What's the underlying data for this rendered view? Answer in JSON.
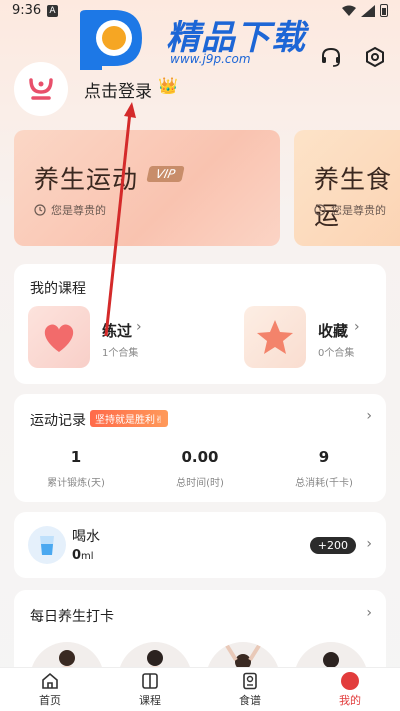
{
  "status": {
    "time": "9:36",
    "a_icon": "A"
  },
  "watermark": {
    "title": "精品下载",
    "url": "www.j9p.com"
  },
  "header": {
    "login_text": "点击登录",
    "avatar_icon": "logo-icon",
    "support_icon": "headset-icon",
    "settings_icon": "gear-icon"
  },
  "vip_cards": [
    {
      "title": "养生运动",
      "badge": "VIP",
      "subtitle": "您是尊贵的"
    },
    {
      "title": "养生食运",
      "subtitle": "您是尊贵的"
    }
  ],
  "courses": {
    "title": "我的课程",
    "items": [
      {
        "name": "练过",
        "count": "1个合集"
      },
      {
        "name": "收藏",
        "count": "0个合集"
      }
    ]
  },
  "record": {
    "title": "运动记录",
    "badge": "坚持就是胜利✌",
    "stats": [
      {
        "value": "1",
        "label": "累计锻炼(天)"
      },
      {
        "value": "0.00",
        "label": "总时间(时)"
      },
      {
        "value": "9",
        "label": "总消耗(千卡)"
      }
    ]
  },
  "water": {
    "title": "喝水",
    "value": "0",
    "unit": "ml",
    "button": "+200"
  },
  "checkin": {
    "title": "每日养生打卡"
  },
  "tabs": [
    {
      "label": "首页",
      "icon": "home-icon"
    },
    {
      "label": "课程",
      "icon": "book-icon"
    },
    {
      "label": "食谱",
      "icon": "recipe-icon"
    },
    {
      "label": "我的",
      "icon": "profile-icon"
    }
  ],
  "colors": {
    "accent": "#e23c3c",
    "watermark_blue": "#1d66d6",
    "arrow": "#d42a2a"
  }
}
